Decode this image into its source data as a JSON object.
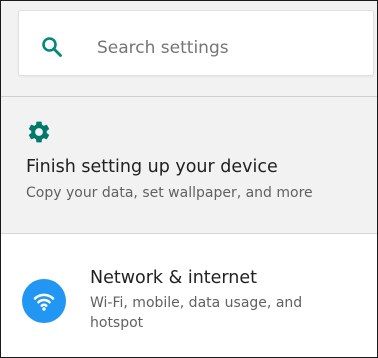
{
  "search": {
    "placeholder": "Search settings",
    "icon": "search-icon",
    "icon_color": "#00897b"
  },
  "suggestion": {
    "icon": "gear-icon",
    "icon_color": "#00796b",
    "title": "Finish setting up your device",
    "summary": "Copy your data, set wallpaper, and more"
  },
  "settings_list": {
    "items": [
      {
        "icon": "wifi-icon",
        "icon_bg": "#2196f3",
        "title": "Network & internet",
        "summary": "Wi-Fi, mobile, data usage, and hotspot"
      }
    ]
  }
}
